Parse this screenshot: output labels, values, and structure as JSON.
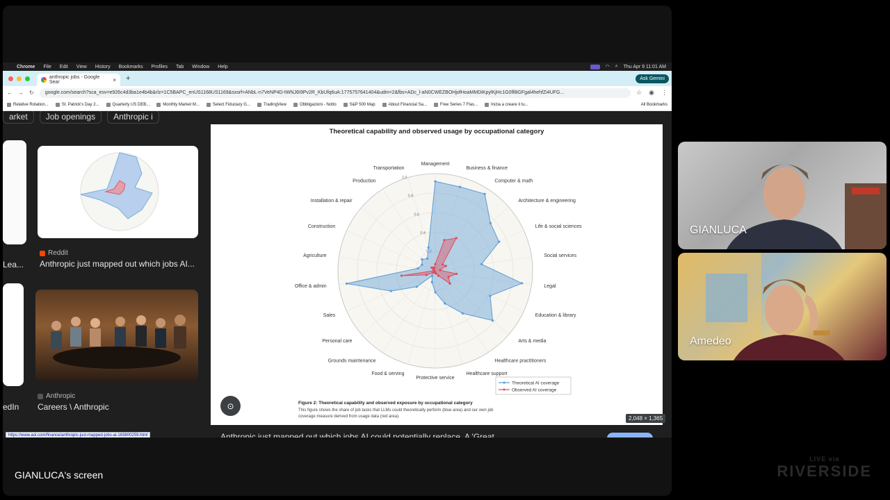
{
  "menubar": {
    "items": [
      "Chrome",
      "File",
      "Edit",
      "View",
      "History",
      "Bookmarks",
      "Profiles",
      "Tab",
      "Window",
      "Help"
    ],
    "datetime": "Thu Apr 9  11:01 AM"
  },
  "tab": {
    "title": "anthropic jobs - Google Sear"
  },
  "gemini_label": "Ask Gemini",
  "url": "google.com/search?sca_esv=e926c4d3ba1e4b4b&rlz=1C5BAPC_enUS1168US1169&sxsrf=ANbL-n7VeNP4D-tWNJ6I9Pv2R_KbUfq6uA:1775757641404&udm=2&fbs=ADc_l-aN0CWEZBOHjofHoaMMDiKpylKjHc1G0fll8GFgal4hehfZi4UFG...",
  "bookmarks": [
    "Relative Rotation...",
    "St. Patrick's Day 2...",
    "Quarterly US DEB...",
    "Monthly Market M...",
    "Select Fiduciary G...",
    "TradingView",
    "Obbligazioni - Notto",
    "S&P 500 Map",
    "About Financial Sa...",
    "Free Series 7 Flas...",
    "Inizia a creare il tu..."
  ],
  "bookmarks_all": "All Bookmarks",
  "chips": [
    "arket",
    "Job openings",
    "Anthropic i"
  ],
  "cards": {
    "left_partial_1": "Lea...",
    "reddit_source": "Reddit",
    "reddit_title": "Anthropic just mapped out which jobs AI...",
    "left_partial_2": "edIn",
    "anthropic_source": "Anthropic",
    "anthropic_title": "Careers \\ Anthropic"
  },
  "viewer": {
    "title": "Theoretical capability and observed usage by occupational category",
    "caption_title": "Figure 2: Theoretical capability and observed exposure by occupational category",
    "caption_body": "This figure shows the share of job tasks that LLMs could theoretically perform (blue area) and our own job coverage measure derived from usage data (red area).",
    "dimensions": "2,048 × 1,365",
    "bottom_text": "Anthropic just mapped out which jobs AI could potentially replace. A 'Great..."
  },
  "status_url": "https://www.aol.com/finance/anthropic-just-mapped-jobs-ai-163800259.html",
  "chart_data": {
    "type": "radar",
    "title": "Theoretical capability and observed usage by occupational category",
    "categories": [
      "Management",
      "Business & finance",
      "Computer & math",
      "Architecture & engineering",
      "Life & social sciences",
      "Social services",
      "Legal",
      "Education & library",
      "Arts & media",
      "Healthcare practitioners",
      "Healthcare support",
      "Protective service",
      "Food & serving",
      "Grounds maintenance",
      "Personal care",
      "Sales",
      "Office & admin",
      "Agriculture",
      "Construction",
      "Installation & repair",
      "Production",
      "Transportation"
    ],
    "rticks": [
      "0.2",
      "0.4",
      "0.6",
      "0.8",
      "1.0"
    ],
    "ylim": [
      0,
      1
    ],
    "series": [
      {
        "name": "Theoretical AI coverage",
        "color": "#5b9bd5",
        "values": [
          0.92,
          0.9,
          0.94,
          0.75,
          0.72,
          0.48,
          0.9,
          0.62,
          0.78,
          0.52,
          0.35,
          0.22,
          0.12,
          0.06,
          0.25,
          0.5,
          0.92,
          0.18,
          0.15,
          0.18,
          0.15,
          0.25
        ]
      },
      {
        "name": "Observed AI coverage",
        "color": "#e04b5a",
        "values": [
          0.07,
          0.33,
          0.4,
          0.1,
          0.12,
          0.05,
          0.22,
          0.15,
          0.2,
          0.06,
          0.03,
          0.02,
          0.02,
          0.01,
          0.03,
          0.1,
          0.35,
          0.01,
          0.02,
          0.05,
          0.04,
          0.03
        ]
      }
    ]
  },
  "screen_label": "GIANLUCA's screen",
  "participants": [
    "GIANLUCA",
    "Amedeo"
  ],
  "brand": {
    "small": "LIVE via",
    "name": "RIVERSIDE"
  }
}
